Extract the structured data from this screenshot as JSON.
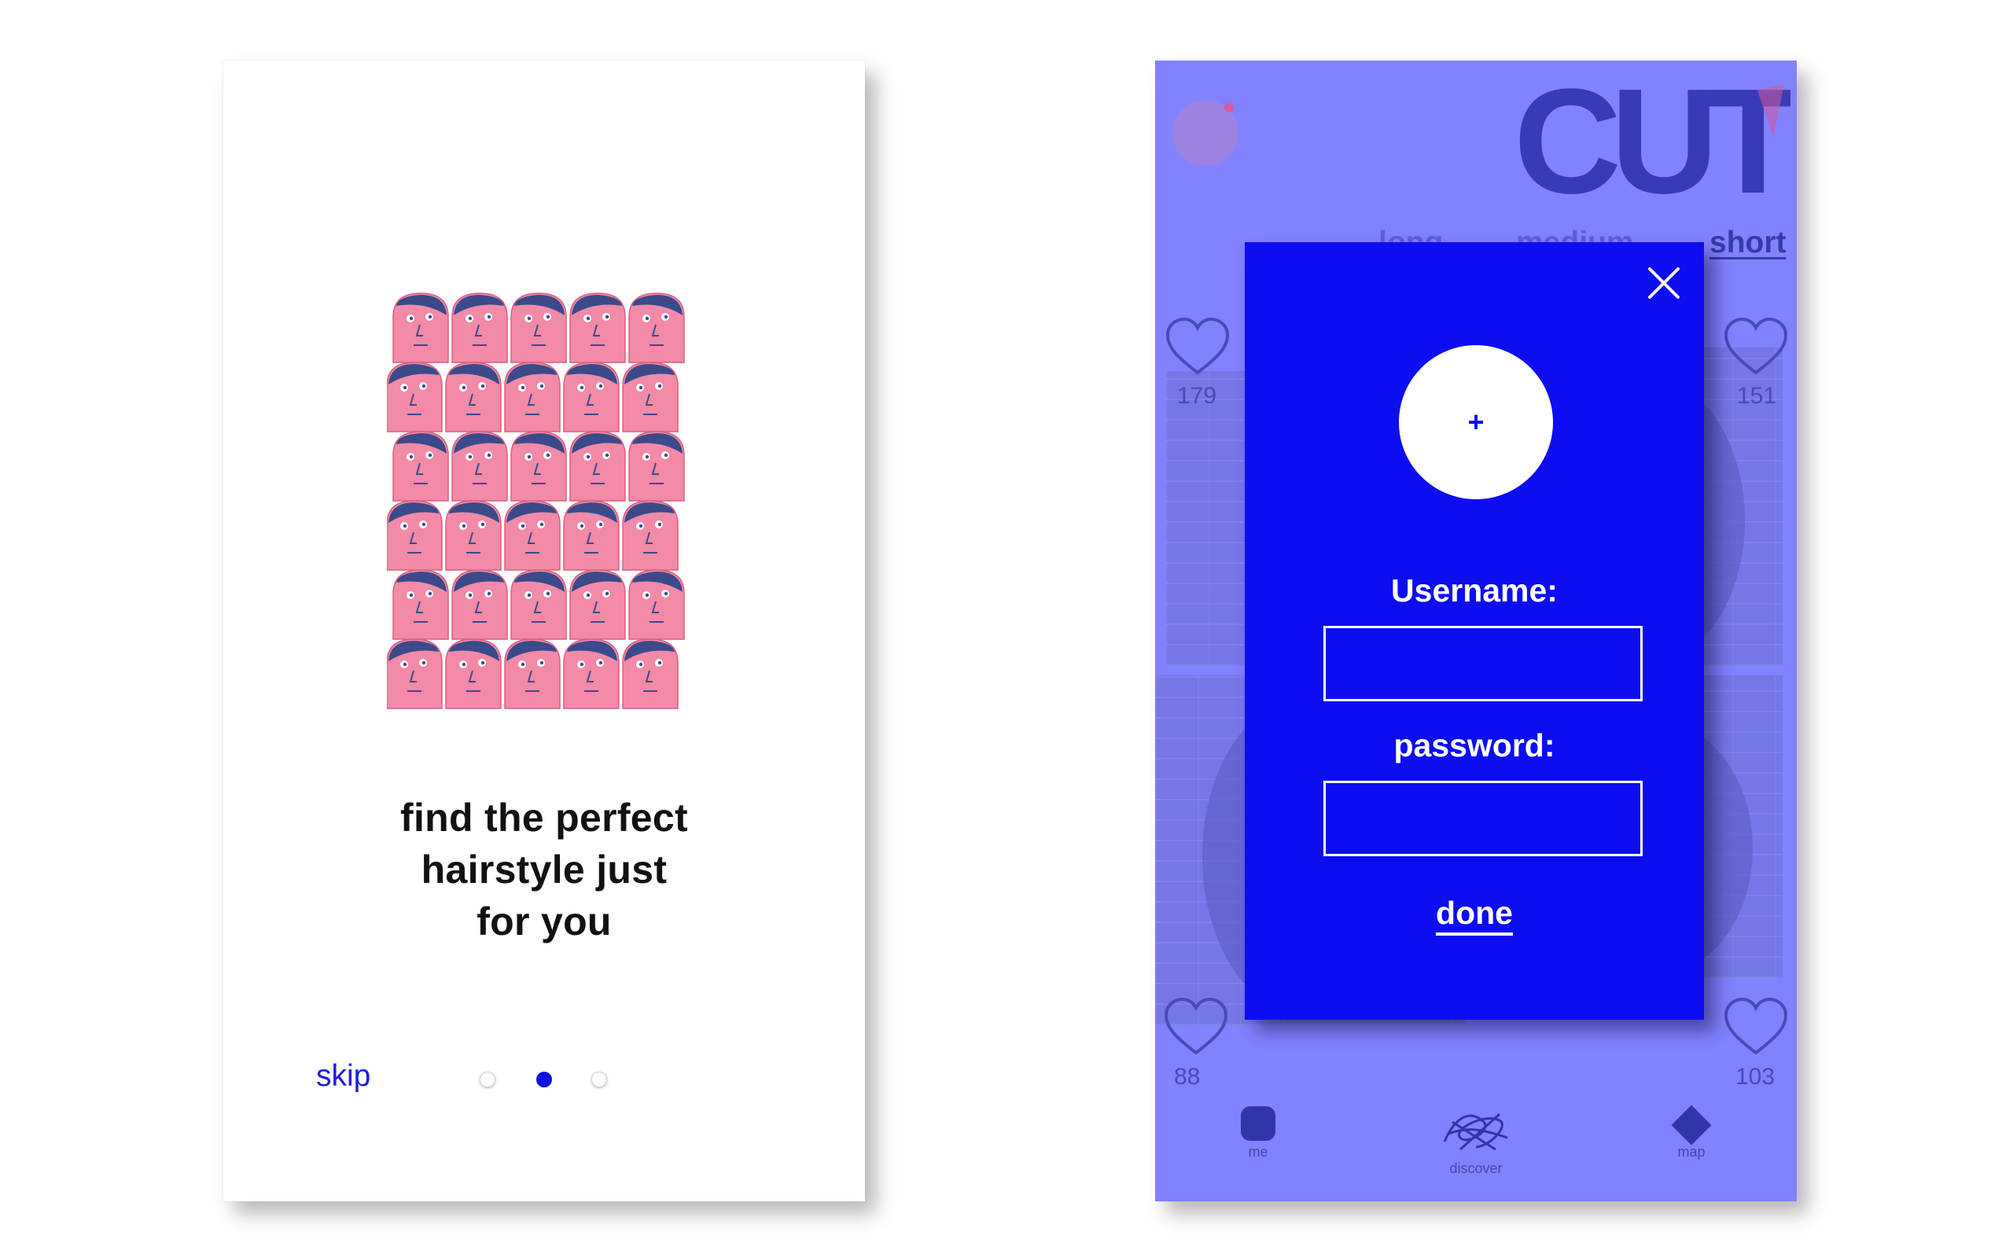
{
  "onboarding": {
    "tagline": "find the perfect\nhairstyle just\nfor you",
    "skip_label": "skip",
    "pager": {
      "count": 3,
      "active_index": 1
    },
    "illustration_icon": "crowd-of-faces-illustration"
  },
  "feed": {
    "logo_text": "CUT",
    "tabs": [
      {
        "label": "long",
        "active": false
      },
      {
        "label": "medium",
        "active": false
      },
      {
        "label": "short",
        "active": true
      }
    ],
    "likes": [
      "179",
      "151",
      "88",
      "103"
    ],
    "nav": [
      {
        "label": "me",
        "icon": "profile-icon"
      },
      {
        "label": "discover",
        "icon": "scribble-icon"
      },
      {
        "label": "map",
        "icon": "diamond-icon"
      }
    ]
  },
  "login_modal": {
    "add_photo_symbol": "+",
    "username_label": "Username:",
    "username_value": "",
    "password_label": "password:",
    "password_value": "",
    "done_label": "done",
    "close_icon": "close-icon"
  },
  "colors": {
    "brand_blue": "#0d0df2",
    "overlay_blue": "#8282ff",
    "face_pink": "#f28aa8",
    "hair_navy": "#3b4a8a"
  }
}
